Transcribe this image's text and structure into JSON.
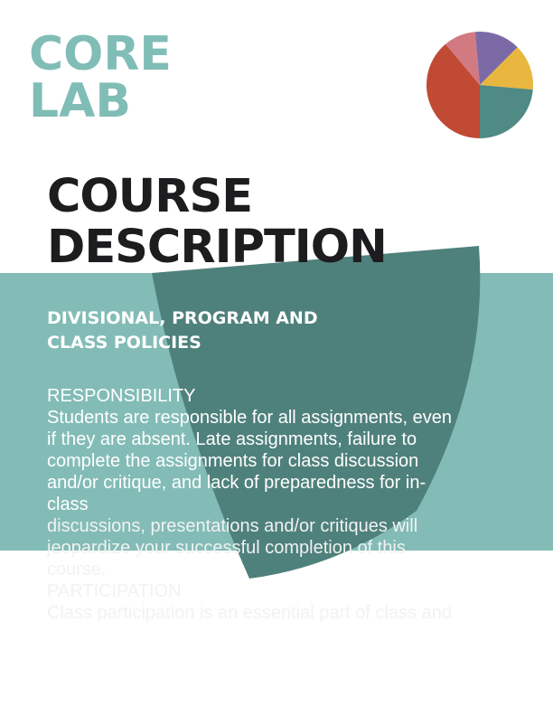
{
  "logo": {
    "line1": "CORE",
    "line2": "LAB"
  },
  "pie_colors": [
    "#c04a33",
    "#d17a82",
    "#7b6aa6",
    "#e9b740",
    "#4f8a84"
  ],
  "colors": {
    "teal_light": "#83bcb6",
    "teal_dark": "#4f817c",
    "logo_teal": "#80bdb6",
    "title": "#1d1d1f"
  },
  "title": {
    "line1": "COURSE",
    "line2": "DESCRIPTION"
  },
  "subheading": {
    "line1": "DIVISIONAL, PROGRAM AND",
    "line2": "CLASS POLICIES"
  },
  "sections": {
    "responsibility_heading": "RESPONSIBILITY",
    "responsibility_lines": [
      "Students are responsible for all assignments, even",
      "if they are absent. Late assignments, failure to",
      "complete the assignments for class discussion",
      "and/or critique, and lack of preparedness for in-",
      "class",
      "discussions, presentations and/or critiques will",
      "jeopardize your successful completion of this",
      "course."
    ],
    "participation_heading": "PARTICIPATION",
    "participation_line": "Class participation is an essential part of class and"
  }
}
